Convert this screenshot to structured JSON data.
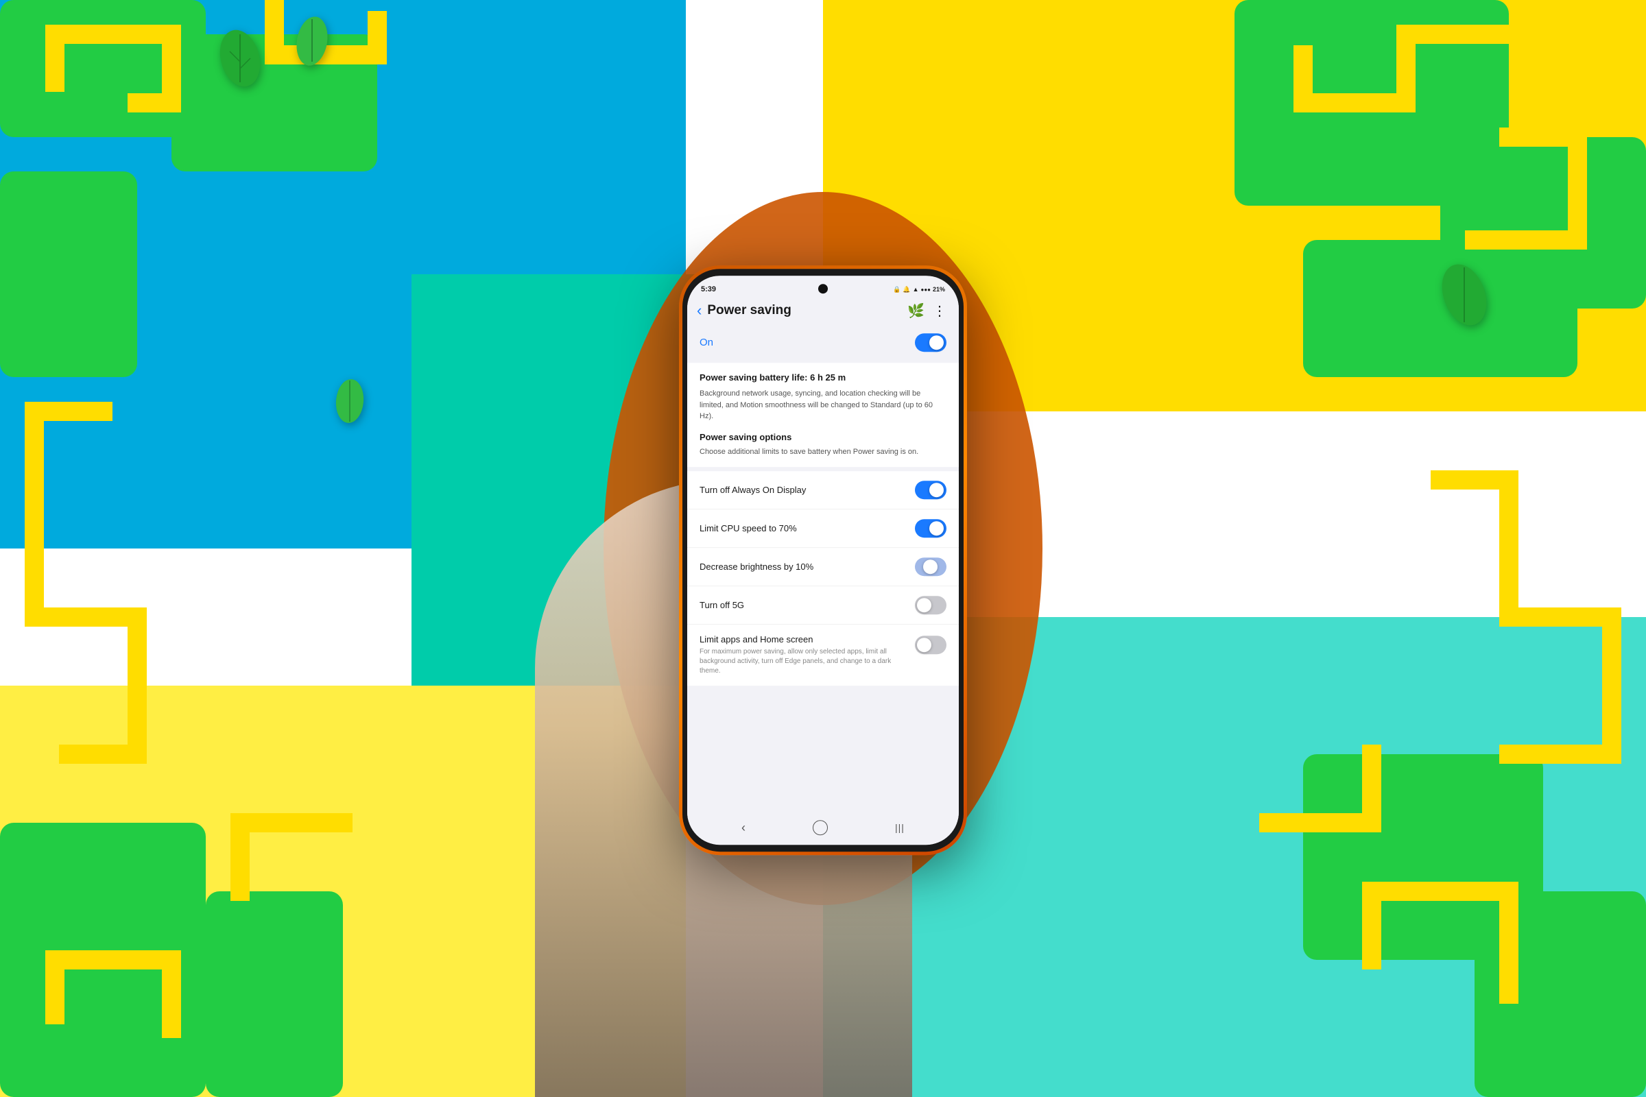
{
  "background": {
    "colors": {
      "blue": "#00aadd",
      "teal": "#00ccaa",
      "yellow": "#ffdd00",
      "orange": "#ff8800",
      "green": "#22cc44"
    }
  },
  "status_bar": {
    "time": "5:39",
    "battery": "21%",
    "signal": "●●●",
    "wifi": "WiFi",
    "icons": "🔒 🔔"
  },
  "header": {
    "title": "Power saving",
    "back_label": "‹",
    "more_label": "⋮",
    "leaf_icon": "🌿"
  },
  "on_toggle": {
    "label": "On",
    "state": "on"
  },
  "battery_info": {
    "life_label": "Power saving battery life: 6 h 25 m",
    "description": "Background network usage, syncing, and location checking will be limited, and Motion smoothness will be changed to Standard (up to 60 Hz)."
  },
  "power_options": {
    "title": "Power saving options",
    "description": "Choose additional limits to save battery when Power saving is on."
  },
  "settings": [
    {
      "label": "Turn off Always On Display",
      "toggle_state": "on",
      "has_desc": false
    },
    {
      "label": "Limit CPU speed to 70%",
      "toggle_state": "on",
      "has_desc": false
    },
    {
      "label": "Decrease brightness by 10%",
      "toggle_state": "partial",
      "has_desc": false
    },
    {
      "label": "Turn off 5G",
      "toggle_state": "off",
      "has_desc": false
    },
    {
      "label": "Limit apps and Home screen",
      "description": "For maximum power saving, allow only selected apps, limit all background activity, turn off Edge panels, and change to a dark theme.",
      "toggle_state": "off",
      "has_desc": true
    }
  ],
  "bottom_nav": {
    "back": "‹",
    "home": "○",
    "recents": "|||"
  }
}
